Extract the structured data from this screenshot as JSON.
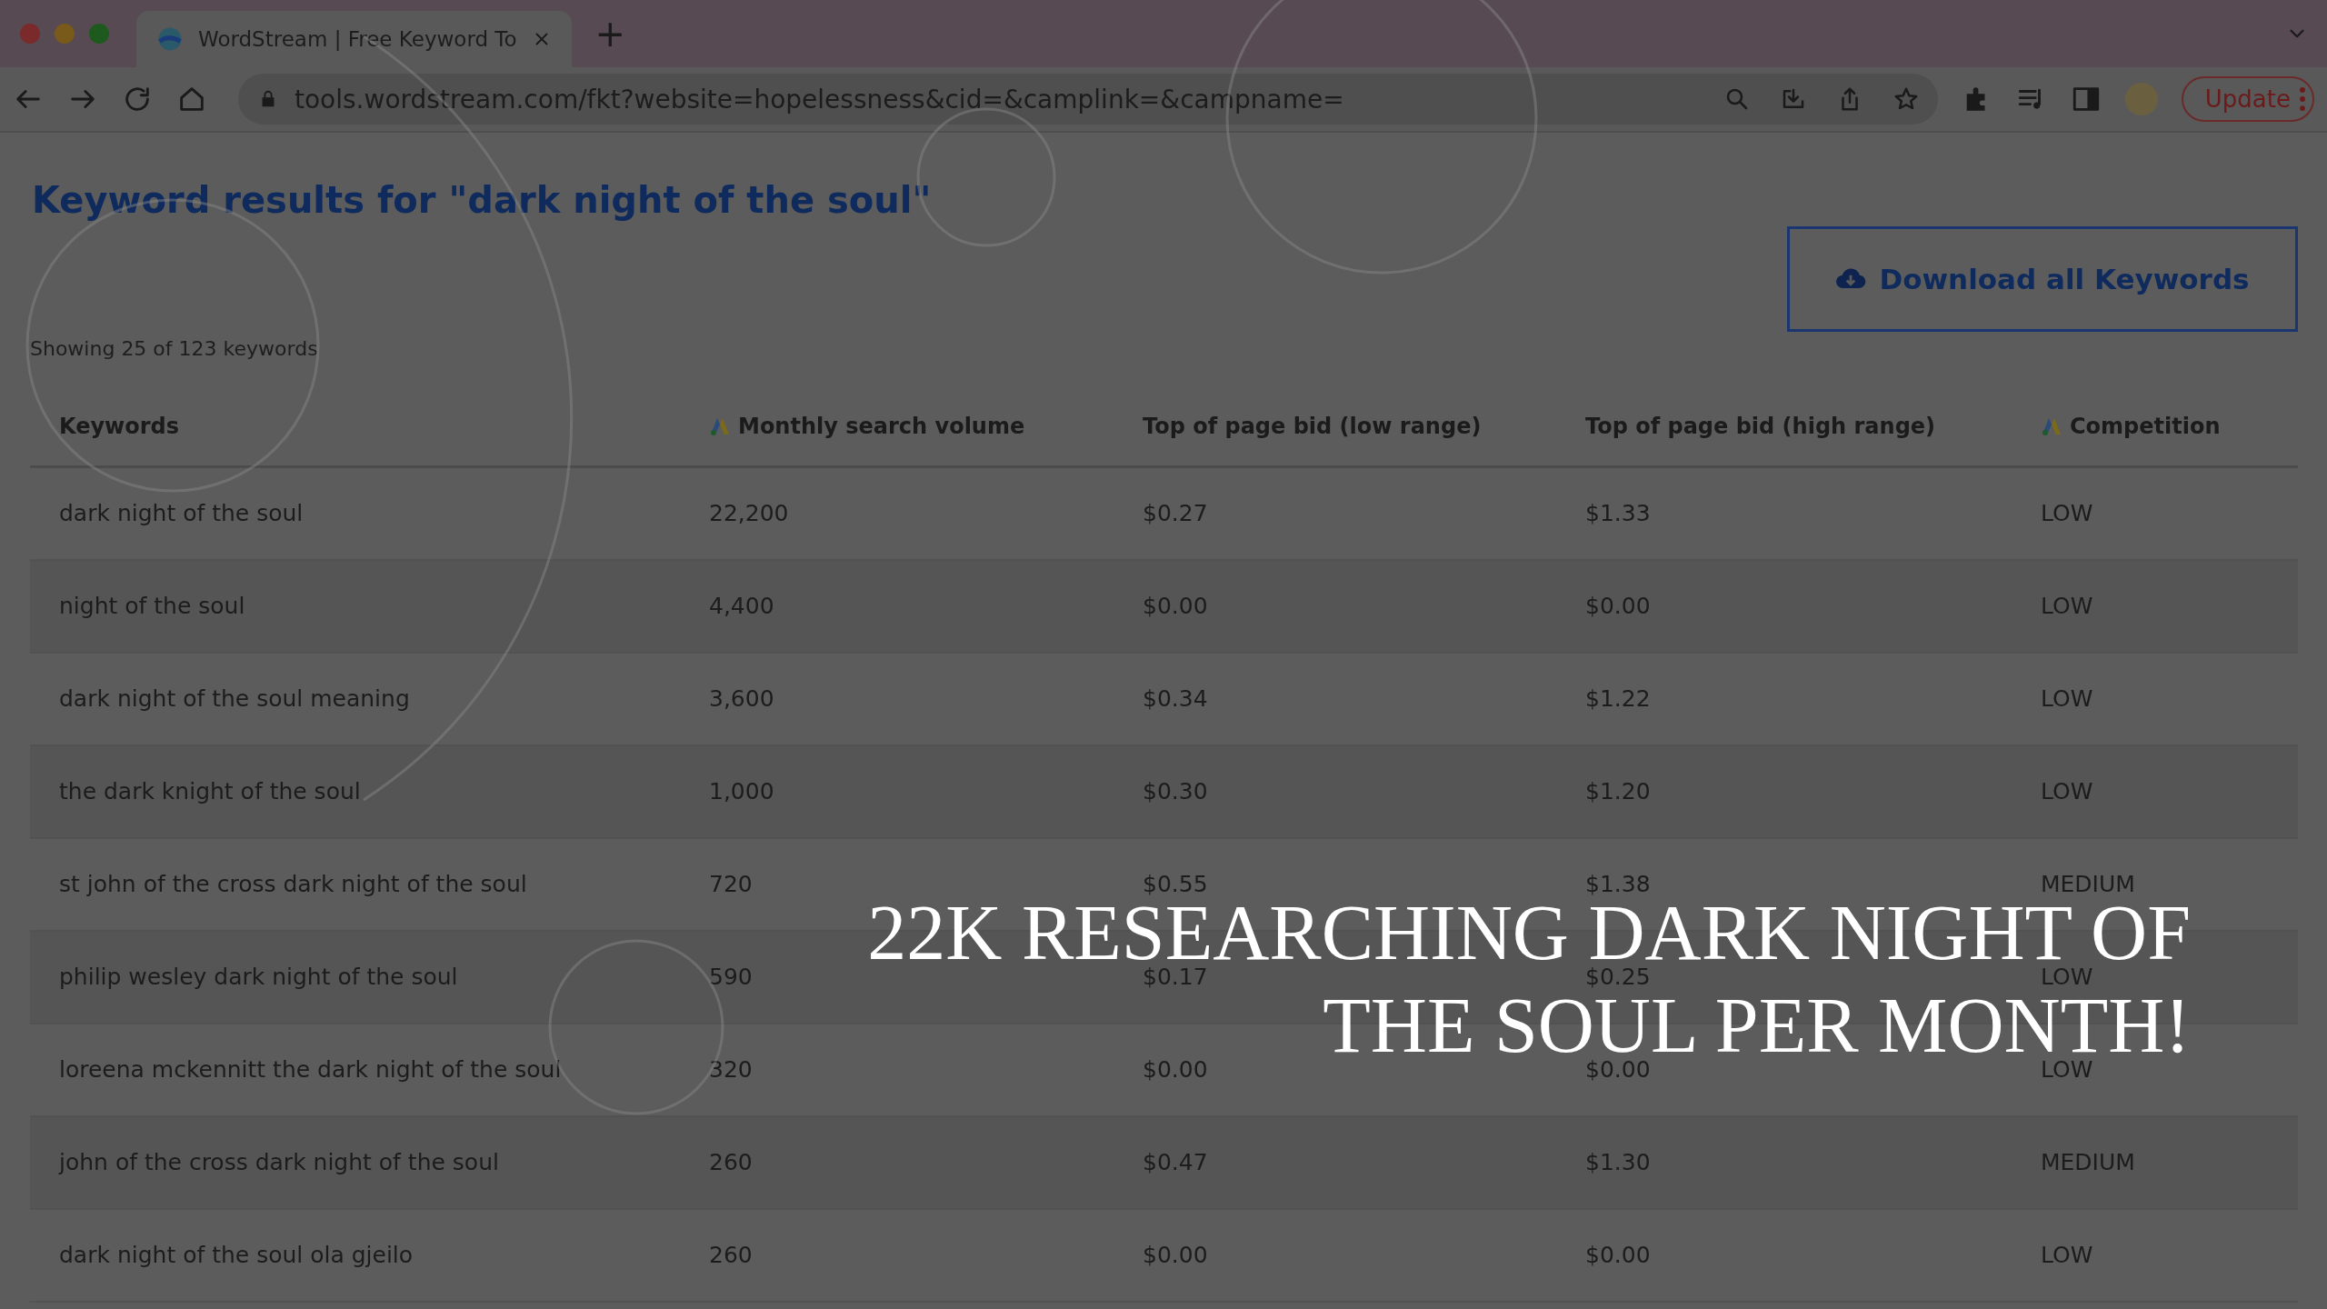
{
  "browser": {
    "tabs": [
      {
        "title": "WordStream | Free Keyword To",
        "selected": true
      }
    ],
    "new_tab": "+",
    "url": "tools.wordstream.com/fkt?website=hopelessness&cid=&camplink=&campname=",
    "update_button": "Update"
  },
  "page": {
    "title": "Keyword results for \"dark night of the soul\"",
    "download_button": "Download all Keywords",
    "count": "Showing 25 of 123 keywords"
  },
  "table": {
    "columns": [
      {
        "label": "Keywords",
        "ads_icon": false
      },
      {
        "label": "Monthly search volume",
        "ads_icon": true
      },
      {
        "label": "Top of page bid (low range)",
        "ads_icon": false
      },
      {
        "label": "Top of page bid (high range)",
        "ads_icon": false
      },
      {
        "label": "Competition",
        "ads_icon": true
      }
    ],
    "rows": [
      [
        "dark night of the soul",
        "22,200",
        "$0.27",
        "$1.33",
        "LOW"
      ],
      [
        "night of the soul",
        "4,400",
        "$0.00",
        "$0.00",
        "LOW"
      ],
      [
        "dark night of the soul meaning",
        "3,600",
        "$0.34",
        "$1.22",
        "LOW"
      ],
      [
        "the dark knight of the soul",
        "1,000",
        "$0.30",
        "$1.20",
        "LOW"
      ],
      [
        "st john of the cross dark night of the soul",
        "720",
        "$0.55",
        "$1.38",
        "MEDIUM"
      ],
      [
        "philip wesley dark night of the soul",
        "590",
        "$0.17",
        "$0.25",
        "LOW"
      ],
      [
        "loreena mckennitt the dark night of the soul",
        "320",
        "$0.00",
        "$0.00",
        "LOW"
      ],
      [
        "john of the cross dark night of the soul",
        "260",
        "$0.47",
        "$1.30",
        "MEDIUM"
      ],
      [
        "dark night of the soul ola gjeilo",
        "260",
        "$0.00",
        "$0.00",
        "LOW"
      ]
    ]
  },
  "caption": "22K RESEARCHING DARK NIGHT OF THE SOUL PER MONTH!"
}
